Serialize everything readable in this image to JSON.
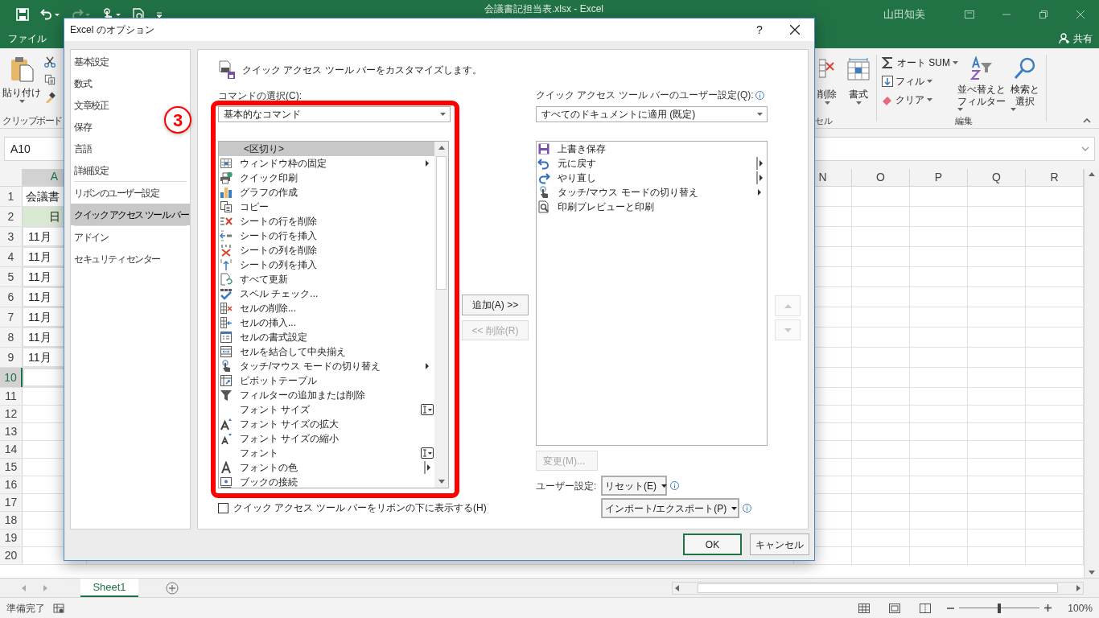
{
  "excel": {
    "title": "会議書記担当表.xlsx - Excel",
    "user": "山田知美",
    "file_tab": "ファイル",
    "share": "共有",
    "clipboard": {
      "paste": "貼り付け",
      "label": "クリップボード"
    },
    "cells_group": {
      "delete": "削除",
      "format": "書式",
      "label": "セル"
    },
    "editing": {
      "autosum": "オート SUM",
      "fill": "フィル",
      "clear": "クリア",
      "sort": [
        "並べ替えと",
        "フィルター"
      ],
      "find": [
        "検索と",
        "選択"
      ],
      "label": "編集"
    },
    "name_box": "A10",
    "columns": [
      {
        "label": "A",
        "selected": true
      },
      {
        "label": "N",
        "selected": false
      },
      {
        "label": "O",
        "selected": false
      },
      {
        "label": "P",
        "selected": false
      },
      {
        "label": "Q",
        "selected": false
      },
      {
        "label": "R",
        "selected": false
      }
    ],
    "rows": [
      {
        "number": "1",
        "kind": "title",
        "cell": "会議書",
        "selected": false
      },
      {
        "number": "2",
        "kind": "header",
        "cell": "日",
        "selected": false
      },
      {
        "number": "3",
        "kind": "data",
        "cell": "11月",
        "selected": false
      },
      {
        "number": "4",
        "kind": "data",
        "cell": "11月",
        "selected": false
      },
      {
        "number": "5",
        "kind": "data",
        "cell": "11月",
        "selected": false
      },
      {
        "number": "6",
        "kind": "data",
        "cell": "11月",
        "selected": false
      },
      {
        "number": "7",
        "kind": "data",
        "cell": "11月",
        "selected": false
      },
      {
        "number": "8",
        "kind": "data",
        "cell": "11月",
        "selected": false
      },
      {
        "number": "9",
        "kind": "data",
        "cell": "11月",
        "selected": false
      },
      {
        "number": "10",
        "kind": "blank",
        "selected": true
      },
      {
        "number": "11",
        "kind": "blank",
        "selected": false
      },
      {
        "number": "12",
        "kind": "blank",
        "selected": false
      },
      {
        "number": "13",
        "kind": "blank",
        "selected": false
      },
      {
        "number": "14",
        "kind": "blank",
        "selected": false
      },
      {
        "number": "15",
        "kind": "blank",
        "selected": false
      },
      {
        "number": "16",
        "kind": "blank",
        "selected": false
      },
      {
        "number": "17",
        "kind": "blank",
        "selected": false
      },
      {
        "number": "18",
        "kind": "blank",
        "selected": false
      },
      {
        "number": "19",
        "kind": "blank",
        "selected": false
      },
      {
        "number": "20",
        "kind": "blank",
        "selected": false
      }
    ],
    "sheets": [
      {
        "label": "Sheet1",
        "selected": true
      }
    ],
    "status": "準備完了",
    "zoom": {
      "level": 0.5,
      "label": "100%"
    }
  },
  "dialog": {
    "title": "Excel のオプション",
    "help": "?",
    "nav_groups": [
      [
        {
          "label": "基本設定",
          "selected": false
        },
        {
          "label": "数式",
          "selected": false
        },
        {
          "label": "文章校正",
          "selected": false
        },
        {
          "label": "保存",
          "selected": false
        },
        {
          "label": "言語",
          "selected": false
        },
        {
          "label": "詳細設定",
          "selected": false
        }
      ],
      [
        {
          "label": "リボンのユーザー設定",
          "selected": false
        },
        {
          "label": "クイック アクセス ツール バー",
          "selected": true
        }
      ],
      [
        {
          "label": "アドイン",
          "selected": false
        },
        {
          "label": "セキュリティ センター",
          "selected": false
        }
      ]
    ],
    "heading": "クイック アクセス ツール バーをカスタマイズします。",
    "commands_label": "コマンドの選択(C):",
    "commands_select": "基本的なコマンド",
    "commands": [
      {
        "label": "<区切り>",
        "selected": true,
        "kind": "plain"
      },
      {
        "label": "ウィンドウ枠の固定",
        "selected": false,
        "kind": "submenu"
      },
      {
        "label": "クイック印刷",
        "selected": false,
        "kind": "plain"
      },
      {
        "label": "グラフの作成",
        "selected": false,
        "kind": "plain"
      },
      {
        "label": "コピー",
        "selected": false,
        "kind": "plain"
      },
      {
        "label": "シートの行を削除",
        "selected": false,
        "kind": "plain"
      },
      {
        "label": "シートの行を挿入",
        "selected": false,
        "kind": "plain"
      },
      {
        "label": "シートの列を削除",
        "selected": false,
        "kind": "plain"
      },
      {
        "label": "シートの列を挿入",
        "selected": false,
        "kind": "plain"
      },
      {
        "label": "すべて更新",
        "selected": false,
        "kind": "plain"
      },
      {
        "label": "スペル チェック...",
        "selected": false,
        "kind": "plain"
      },
      {
        "label": "セルの削除...",
        "selected": false,
        "kind": "plain"
      },
      {
        "label": "セルの挿入...",
        "selected": false,
        "kind": "plain"
      },
      {
        "label": "セルの書式設定",
        "selected": false,
        "kind": "plain"
      },
      {
        "label": "セルを結合して中央揃え",
        "selected": false,
        "kind": "plain"
      },
      {
        "label": "タッチ/マウス モードの切り替え",
        "selected": false,
        "kind": "submenu"
      },
      {
        "label": "ピボットテーブル",
        "selected": false,
        "kind": "plain"
      },
      {
        "label": "フィルターの追加または削除",
        "selected": false,
        "kind": "plain"
      },
      {
        "label": "フォント サイズ",
        "selected": false,
        "kind": "field"
      },
      {
        "label": "フォント サイズの拡大",
        "selected": false,
        "kind": "plain"
      },
      {
        "label": "フォント サイズの縮小",
        "selected": false,
        "kind": "plain"
      },
      {
        "label": "フォント",
        "selected": false,
        "kind": "field"
      },
      {
        "label": "フォントの色",
        "selected": false,
        "kind": "split"
      },
      {
        "label": "ブックの接続",
        "selected": false,
        "kind": "plain"
      }
    ],
    "add_button": {
      "label": "追加(A) >>",
      "disabled": false
    },
    "remove_button": {
      "label": "<< 削除(R)",
      "disabled": true
    },
    "below_ribbon": {
      "label": "クイック アクセス ツール バーをリボンの下に表示する(H)",
      "checked": false
    },
    "target_label": "クイック アクセス ツール バーのユーザー設定(Q):",
    "target_select": "すべてのドキュメントに適用 (既定)",
    "toolbar_items": [
      {
        "label": "上書き保存",
        "kind": "plain"
      },
      {
        "label": "元に戻す",
        "kind": "split"
      },
      {
        "label": "やり直し",
        "kind": "split"
      },
      {
        "label": "タッチ/マウス モードの切り替え",
        "kind": "submenu"
      },
      {
        "label": "印刷プレビューと印刷",
        "kind": "plain"
      }
    ],
    "modify_button": {
      "label": "変更(M)...",
      "disabled": true
    },
    "move_up": {
      "disabled": true
    },
    "move_down": {
      "disabled": true
    },
    "customizations_label": "ユーザー設定:",
    "reset_button": "リセット(E)",
    "import_export_button": "インポート/エクスポート(P)",
    "ok": "OK",
    "cancel": "キャンセル"
  },
  "annotation": {
    "step": "3"
  }
}
